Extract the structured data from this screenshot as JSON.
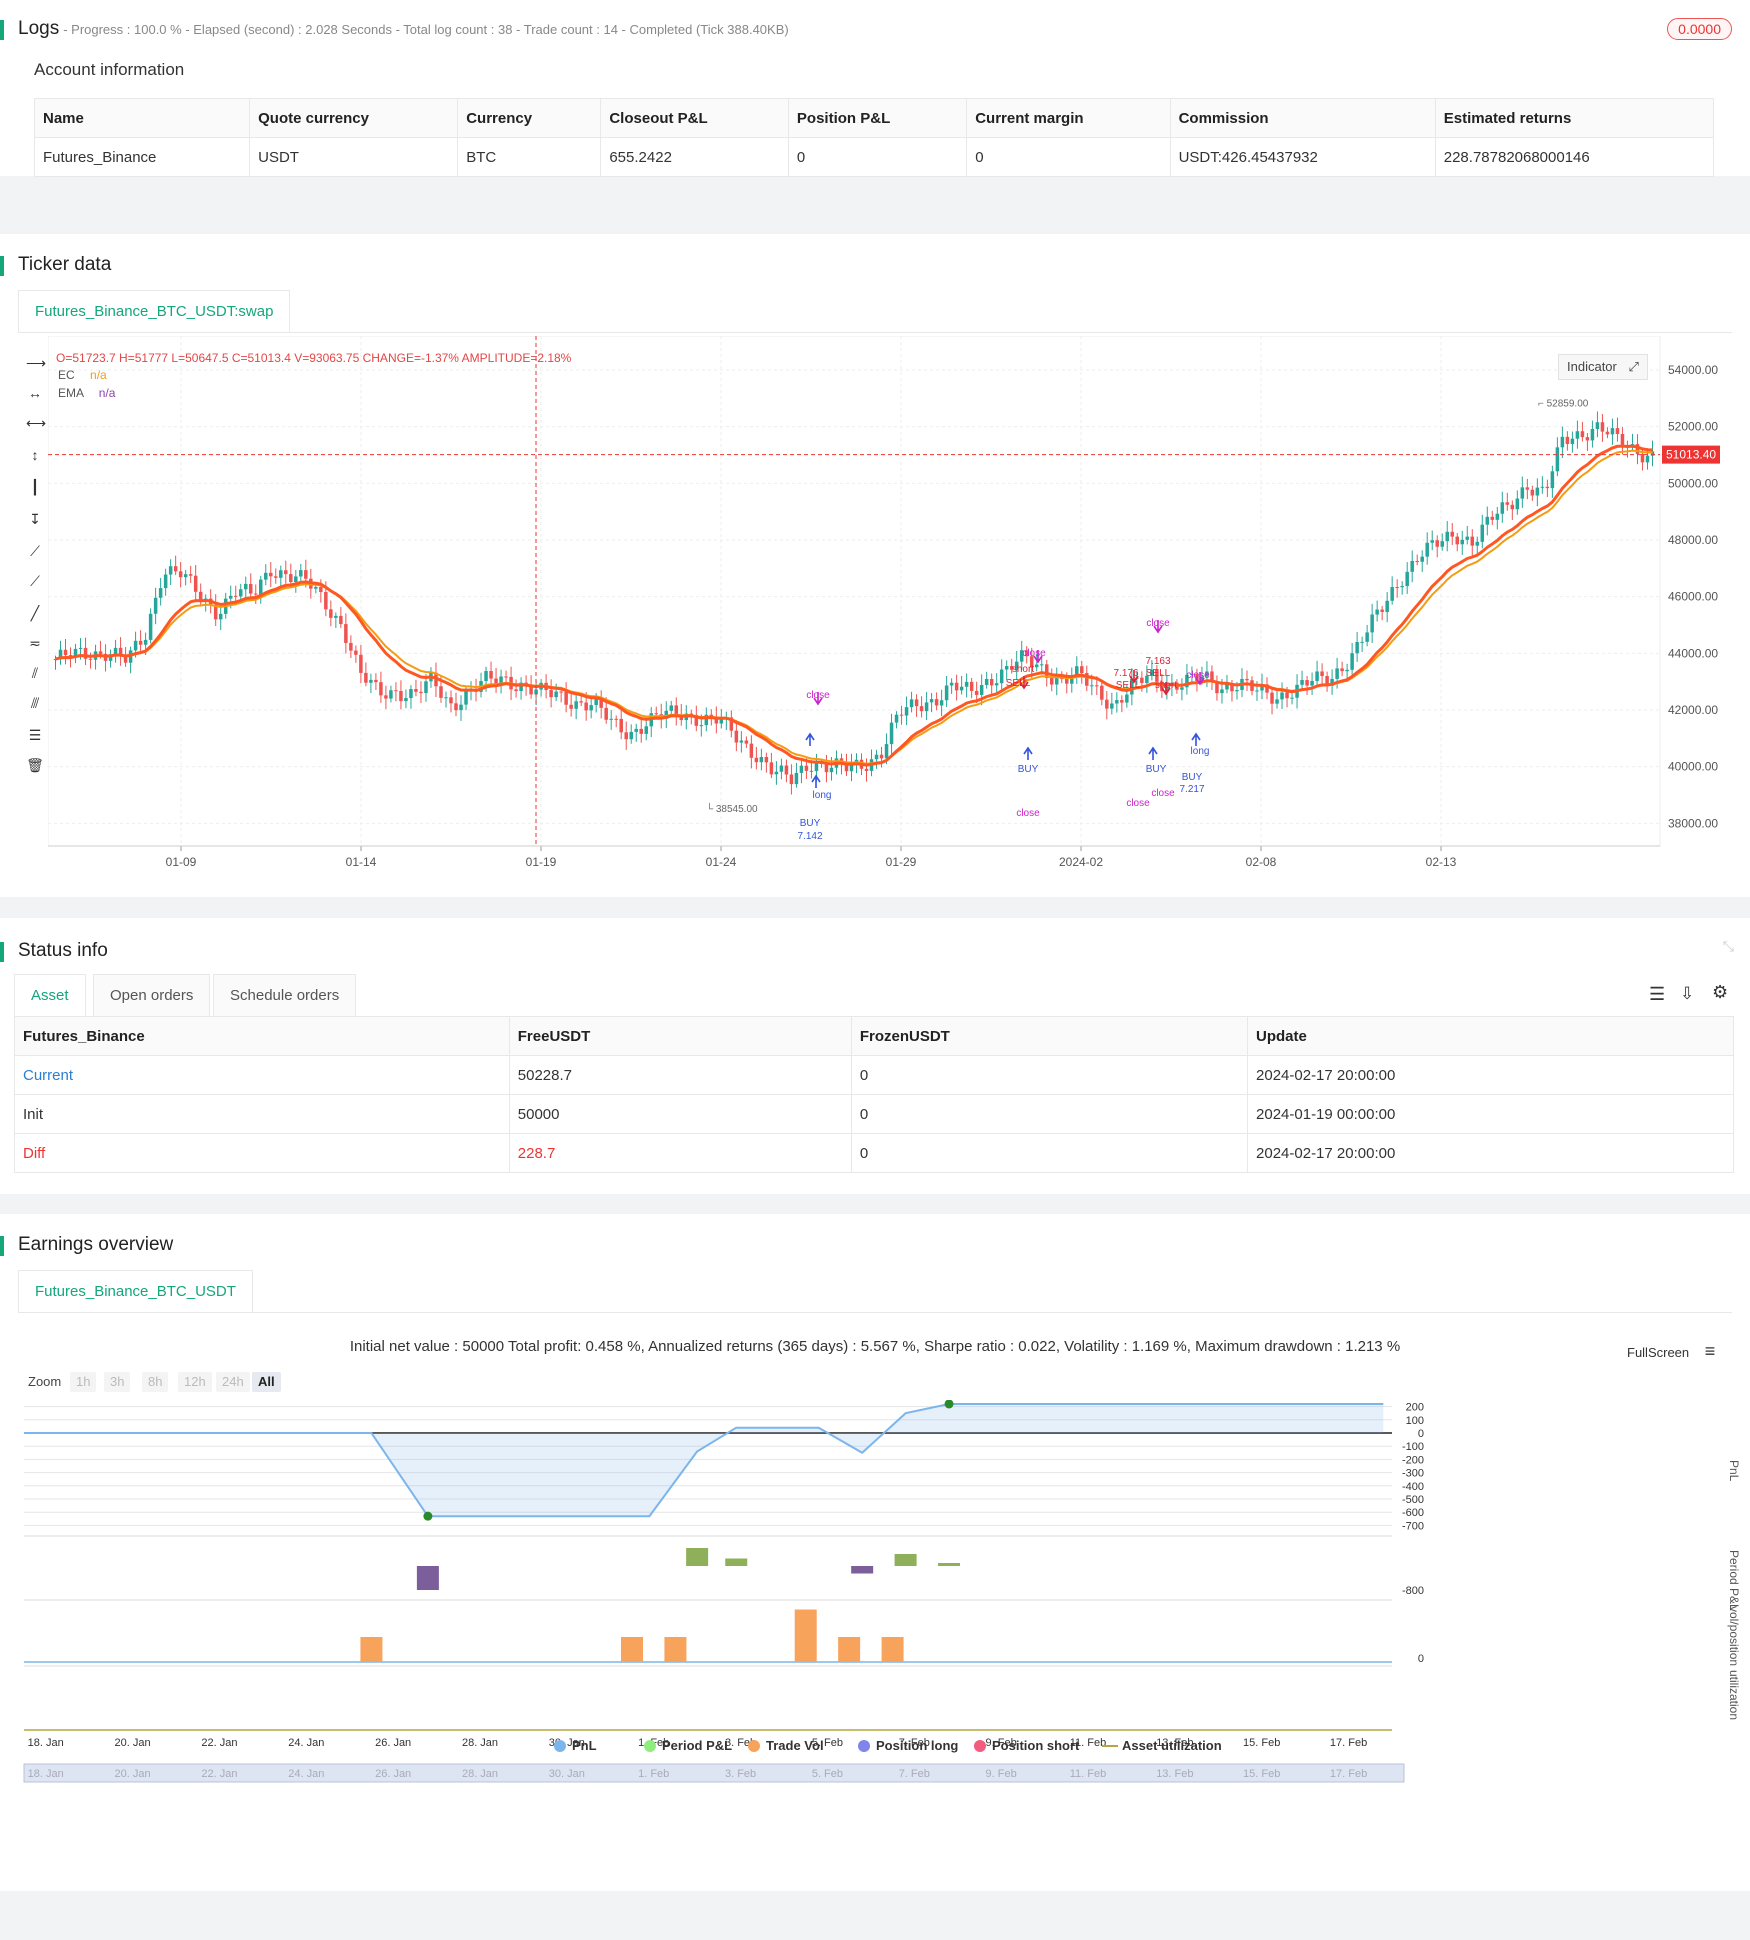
{
  "logs": {
    "title": "Logs",
    "progress": "- Progress : 100.0 % - Elapsed (second) : 2.028  Seconds - Total log count : 38 - Trade count : 14 - Completed (Tick 388.40KB)",
    "badge": "0.0000"
  },
  "account": {
    "heading": "Account information",
    "columns": [
      "Name",
      "Quote currency",
      "Currency",
      "Closeout P&L",
      "Position P&L",
      "Current margin",
      "Commission",
      "Estimated returns"
    ],
    "row": [
      "Futures_Binance",
      "USDT",
      "BTC",
      "655.2422",
      "0",
      "0",
      "USDT:426.45437932",
      "228.78782068000146"
    ]
  },
  "ticker": {
    "title": "Ticker data",
    "tab": "Futures_Binance_BTC_USDT:swap",
    "ohlc": "O=51723.7 H=51777 L=50647.5 C=51013.4 V=93063.75 CHANGE=-1.37% AMPLITUDE=2.18%",
    "legend": [
      {
        "name": "EC",
        "value": "n/a",
        "color": "#f39c12"
      },
      {
        "name": "EMA",
        "value": "n/a",
        "color": "#8e44ad"
      }
    ],
    "indicator_btn": "Indicator",
    "price_label": "51013.40",
    "high_label": "52859.00",
    "low_label": "38545.00",
    "colors": {
      "up": "#26a69a",
      "down": "#ef5350",
      "ec": "#f39c12",
      "ema": "#ff5722"
    }
  },
  "chart_data": [
    {
      "type": "candlestick",
      "title": "",
      "x_ticks": [
        "01-09",
        "01-14",
        "01-19",
        "01-24",
        "01-29",
        "2024-02",
        "02-08",
        "02-13"
      ],
      "y_ticks": [
        "54000.00",
        "52000.00",
        "50000.00",
        "48000.00",
        "46000.00",
        "44000.00",
        "42000.00",
        "40000.00",
        "38000.00"
      ],
      "ylim": [
        37200,
        55200
      ],
      "close_path": [
        43800,
        43900,
        44000,
        44100,
        43700,
        44600,
        47000,
        46800,
        46000,
        45500,
        46200,
        46000,
        47000,
        46800,
        46500,
        45800,
        45000,
        43200,
        42600,
        42700,
        42500,
        43000,
        42200,
        42600,
        43000,
        43100,
        42900,
        42600,
        42500,
        42300,
        42200,
        41500,
        41200,
        41600,
        41800,
        41900,
        41700,
        41600,
        41000,
        40500,
        39800,
        39500,
        40200,
        40000,
        39900,
        40100,
        40500,
        41800,
        42200,
        42400,
        42800,
        42600,
        43100,
        43400,
        43800,
        43500,
        43000,
        43200,
        42700,
        42200,
        42800,
        43200,
        42900,
        43000,
        43100,
        42800,
        43000,
        42600,
        42400,
        42800,
        43000,
        43000,
        43800,
        44700,
        45600,
        46700,
        47500,
        47800,
        48200,
        48000,
        48700,
        49200,
        50000,
        49600,
        51500,
        51800,
        52000,
        51500,
        51200,
        51013
      ],
      "markers": [
        {
          "text": "close",
          "color": "#cc22cc"
        },
        {
          "text": "long",
          "color": "#3355dd"
        },
        {
          "text": "BUY",
          "color": "#3355dd"
        },
        {
          "text": "7.142",
          "color": "#3355dd"
        },
        {
          "text": "SELL",
          "color": "#dd2233"
        },
        {
          "text": "short",
          "color": "#dd2233"
        },
        {
          "text": "7.176",
          "color": "#dd2233"
        },
        {
          "text": "7.163",
          "color": "#dd2233"
        },
        {
          "text": "7.217",
          "color": "#3355dd"
        }
      ]
    },
    {
      "type": "line",
      "title": "Initial net value : 50000 Total profit: 0.458 %, Annualized returns (365 days) : 5.567 %, Sharpe ratio : 0.022, Volatility : 1.169 %, Maximum drawdown : 1.213 %",
      "x_ticks": [
        "18. Jan",
        "20. Jan",
        "22. Jan",
        "24. Jan",
        "26. Jan",
        "28. Jan",
        "30. Jan",
        "1. Feb",
        "3. Feb",
        "5. Feb",
        "7. Feb",
        "9. Feb",
        "11. Feb",
        "13. Feb",
        "15. Feb",
        "17. Feb"
      ],
      "pnl_y_ticks": [
        "200",
        "100",
        "0",
        "-100",
        "-200",
        "-300",
        "-400",
        "-500",
        "-600",
        "-700"
      ],
      "pnl_ylim": [
        -750,
        250
      ],
      "pnl": [
        [
          0,
          0
        ],
        [
          8,
          0
        ],
        [
          9.3,
          -630
        ],
        [
          14.4,
          -630
        ],
        [
          15.5,
          -140
        ],
        [
          16.4,
          40
        ],
        [
          18.3,
          40
        ],
        [
          19.3,
          -150
        ],
        [
          20.3,
          150
        ],
        [
          21.3,
          220
        ],
        [
          31.3,
          220
        ]
      ],
      "period_pnl_label": "-800",
      "period_pnl": [
        [
          9.3,
          -160,
          "#7b5e9a"
        ],
        [
          15.5,
          120,
          "#8fb05a"
        ],
        [
          16.4,
          50,
          "#8fb05a"
        ],
        [
          19.3,
          -50,
          "#7b5e9a"
        ],
        [
          20.3,
          80,
          "#8fb05a"
        ],
        [
          21.3,
          20,
          "#8fb05a"
        ]
      ],
      "trade_vol_label": "0",
      "trade_vol": [
        [
          8,
          1
        ],
        [
          14,
          1
        ],
        [
          15,
          1
        ],
        [
          18,
          2.1
        ],
        [
          19,
          1
        ],
        [
          20,
          1
        ]
      ],
      "axis_titles": [
        "PnL",
        "Period P&L",
        "vol/position",
        "utilization"
      ],
      "legend": [
        {
          "name": "PnL",
          "color": "#7cb5ec"
        },
        {
          "name": "Period P&L",
          "color": "#90ed7d"
        },
        {
          "name": "Trade Vol",
          "color": "#f7a35c"
        },
        {
          "name": "Position long",
          "color": "#8085e9"
        },
        {
          "name": "Position short",
          "color": "#f15c80"
        },
        {
          "name": "Asset utilization",
          "color": "#b5a642"
        }
      ]
    }
  ],
  "status": {
    "title": "Status info",
    "tabs": [
      "Asset",
      "Open orders",
      "Schedule orders"
    ],
    "columns": [
      "Futures_Binance",
      "FreeUSDT",
      "FrozenUSDT",
      "Update"
    ],
    "rows": [
      [
        "Current",
        "50228.7",
        "0",
        "2024-02-17 20:00:00"
      ],
      [
        "Init",
        "50000",
        "0",
        "2024-01-19 00:00:00"
      ],
      [
        "Diff",
        "228.7",
        "0",
        "2024-02-17 20:00:00"
      ]
    ]
  },
  "earnings": {
    "title": "Earnings overview",
    "tab": "Futures_Binance_BTC_USDT",
    "fullscreen": "FullScreen",
    "zoom_label": "Zoom",
    "zoom_options": [
      "1h",
      "3h",
      "8h",
      "12h",
      "24h",
      "All"
    ]
  }
}
